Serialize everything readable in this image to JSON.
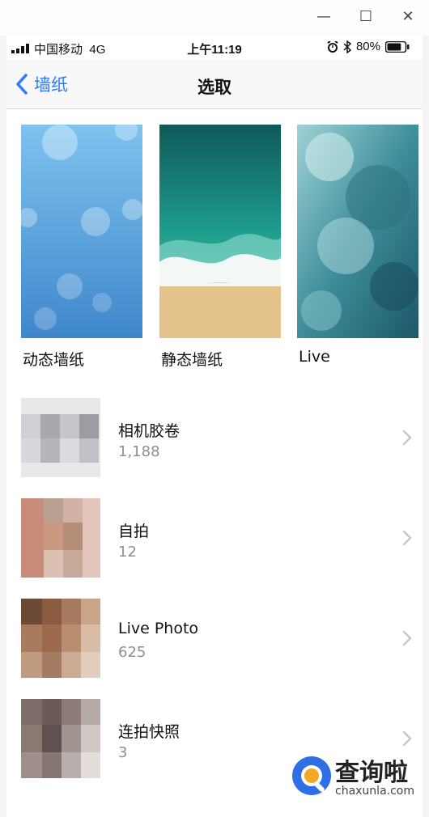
{
  "window": {
    "minimize_glyph": "—",
    "maximize_glyph": "☐",
    "close_glyph": "✕"
  },
  "status_bar": {
    "carrier": "中国移动",
    "network": "4G",
    "time": "上午11:19",
    "battery_percent": "80%",
    "battery_level": 0.8
  },
  "nav": {
    "back_label": "墙纸",
    "title": "选取"
  },
  "wallpapers": [
    {
      "label": "动态墙纸",
      "icon": "dynamic-wallpaper-thumbnail"
    },
    {
      "label": "静态墙纸",
      "icon": "still-wallpaper-thumbnail"
    },
    {
      "label": "Live",
      "icon": "live-wallpaper-thumbnail"
    }
  ],
  "albums": [
    {
      "name": "相机胶卷",
      "count": "1,188"
    },
    {
      "name": "自拍",
      "count": "12"
    },
    {
      "name": "Live Photo",
      "count": "625"
    },
    {
      "name": "连拍快照",
      "count": "3"
    }
  ],
  "watermark": {
    "text": "查询啦",
    "sub": "chaxunla.com"
  },
  "colors": {
    "accent": "#2f7bf5",
    "secondary_text": "#8e8e93",
    "separator": "#d9d9dd"
  }
}
